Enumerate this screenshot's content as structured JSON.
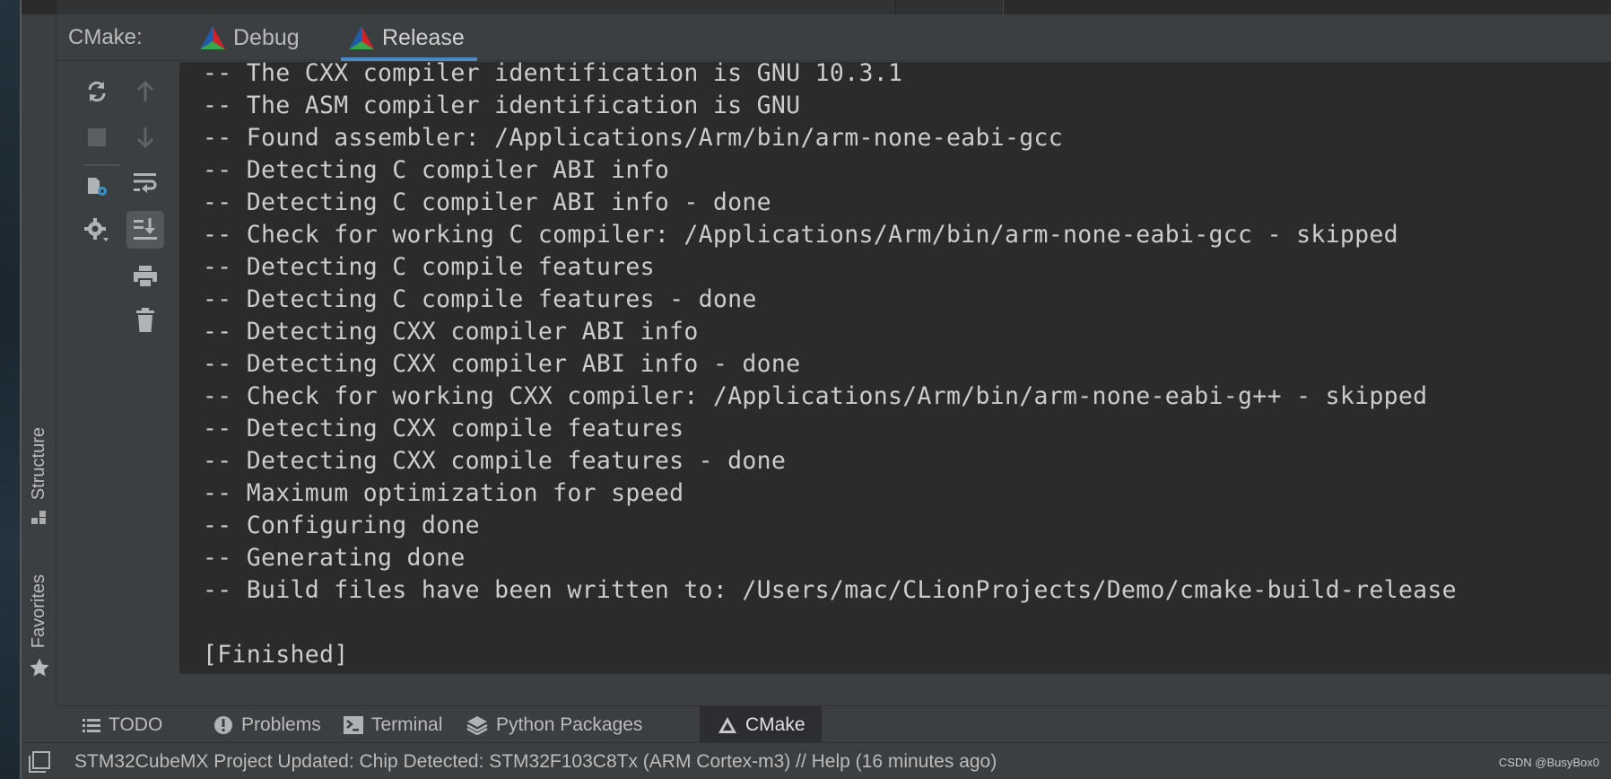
{
  "tool_window": {
    "title": "CMake:",
    "tabs": [
      {
        "label": "Debug",
        "active": false
      },
      {
        "label": "Release",
        "active": true
      }
    ]
  },
  "toolbar": {
    "icons": [
      "reload-icon",
      "stop-icon",
      "scroll-up-icon",
      "scroll-down-icon",
      "settings-file-icon",
      "soft-wrap-icon",
      "scroll-to-end-icon",
      "gear-icon",
      "print-icon",
      "trash-icon"
    ]
  },
  "console": {
    "lines": [
      "-- The CXX compiler identification is GNU 10.3.1",
      "-- The ASM compiler identification is GNU",
      "-- Found assembler: /Applications/Arm/bin/arm-none-eabi-gcc",
      "-- Detecting C compiler ABI info",
      "-- Detecting C compiler ABI info - done",
      "-- Check for working C compiler: /Applications/Arm/bin/arm-none-eabi-gcc - skipped",
      "-- Detecting C compile features",
      "-- Detecting C compile features - done",
      "-- Detecting CXX compiler ABI info",
      "-- Detecting CXX compiler ABI info - done",
      "-- Check for working CXX compiler: /Applications/Arm/bin/arm-none-eabi-g++ - skipped",
      "-- Detecting CXX compile features",
      "-- Detecting CXX compile features - done",
      "-- Maximum optimization for speed",
      "-- Configuring done",
      "-- Generating done",
      "-- Build files have been written to: /Users/mac/CLionProjects/Demo/cmake-build-release",
      "",
      "[Finished]"
    ]
  },
  "side_stripe": {
    "structure_label": "Structure",
    "favorites_label": "Favorites"
  },
  "bottom_bar": {
    "items": [
      {
        "label": "TODO",
        "icon": "list-icon",
        "active": false
      },
      {
        "label": "Problems",
        "icon": "problems-icon",
        "active": false
      },
      {
        "label": "Terminal",
        "icon": "terminal-icon",
        "active": false
      },
      {
        "label": "Python Packages",
        "icon": "layers-icon",
        "active": false
      },
      {
        "label": "CMake",
        "icon": "cmake-icon",
        "active": true
      }
    ]
  },
  "status_bar": {
    "message": "STM32CubeMX Project Updated: Chip Detected: STM32F103C8Tx (ARM Cortex-m3) // Help (16 minutes ago)",
    "watermark": "CSDN @BusyBox0"
  },
  "colors": {
    "accent": "#4a88c7",
    "console_bg": "#2b2b2b",
    "panel_bg": "#3c3f41",
    "text": "#cccccc",
    "cmake_red": "#d1232a",
    "cmake_blue": "#1f5ba8",
    "cmake_green": "#3aa64b"
  }
}
